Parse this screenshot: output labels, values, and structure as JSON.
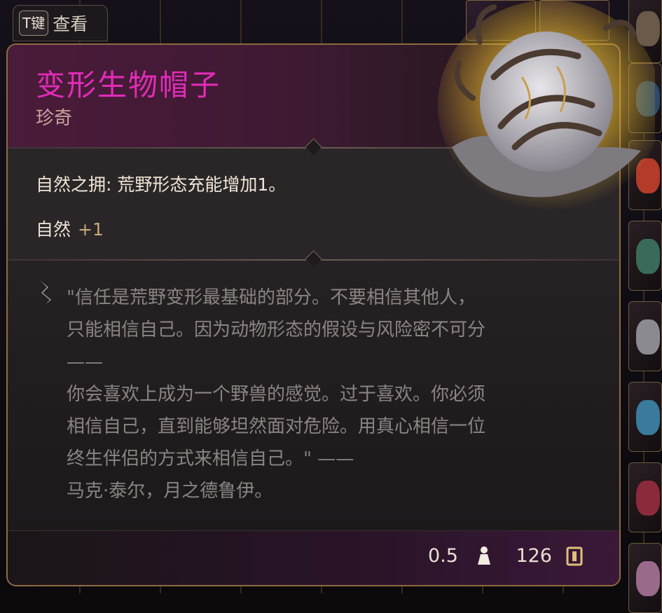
{
  "hint": {
    "key": "T键",
    "label": "查看"
  },
  "item": {
    "name": "变形生物帽子",
    "rarity": "珍奇",
    "effect": "自然之拥: 荒野形态充能增加1。",
    "stat_name": "自然",
    "stat_value": "+1",
    "lore_lines": [
      "\"信任是荒野变形最基础的部分。不要相信其他人，",
      "只能相信自己。因为动物形态的假设与风险密不可分",
      "——",
      "你会喜欢上成为一个野兽的感觉。过于喜欢。你必须",
      "相信自己，直到能够坦然面对危险。用真心相信一位",
      "终生伴侣的方式来相信自己。\" ——",
      "马克·泰尔，月之德鲁伊。"
    ],
    "weight": "0.5",
    "price": "126"
  },
  "colors": {
    "title": "#e22bb8",
    "rarity": "#c9a79d",
    "stat_bonus": "#c6a97a",
    "lore": "#8a8484",
    "border": "#8f6b3f"
  },
  "icons": {
    "quote": "quote-mark-icon",
    "weight": "weight-icon",
    "gold": "gold-coin-icon",
    "item": "hat-item-icon"
  }
}
